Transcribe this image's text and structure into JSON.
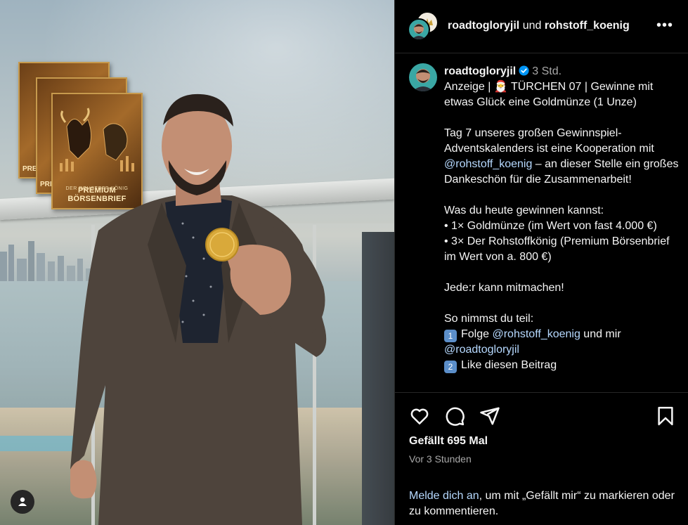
{
  "post": {
    "author": "roadtogloryjil",
    "connector": "und",
    "collaborator": "rohstoff_koenig",
    "more_label": "•••"
  },
  "image": {
    "book_brand": "DER ROHSTOFF-KÖNIG",
    "book_title": "PREMIUM BÖRSENBRIEF",
    "book_partial": "PRE"
  },
  "caption": {
    "username": "roadtogloryjil",
    "time": "3 Std.",
    "line1_pre": "Anzeige | 🎅 TÜRCHEN 07 | Gewinne mit etwas Glück eine Goldmünze (1 Unze)",
    "p2_a": "Tag 7 unseres großen Gewinnspiel-Adventskalenders ist eine Kooperation mit",
    "p2_mention": "@rohstoff_koenig",
    "p2_b": " – an dieser Stelle ein großes Dankeschön für die Zusammenarbeit!",
    "p3_title": "Was du heute gewinnen kannst:",
    "p3_item1": "• 1× Goldmünze (im Wert von fast 4.000 €)",
    "p3_item2": "• 3× Der Rohstoffkönig (Premium Börsenbrief im Wert von a. 800 €)",
    "p4": "Jede:r kann mitmachen!",
    "p5_title": "So nimmst du teil:",
    "step1_num": "1",
    "step1_text": "Folge",
    "step1_mention1": "@rohstoff_koenig",
    "step1_mid": " und mir",
    "step1_mention2": "@roadtogloryjil",
    "step2_num": "2",
    "step2_text": "Like diesen Beitrag"
  },
  "actions": {
    "like_icon": "heart-icon",
    "comment_icon": "comment-icon",
    "share_icon": "share-icon",
    "save_icon": "bookmark-icon",
    "likes_text": "Gefällt 695 Mal",
    "time_ago": "Vor 3 Stunden",
    "login_link": "Melde dich an",
    "login_rest": ", um mit „Gefällt mir“ zu markieren oder zu kommentieren."
  },
  "colors": {
    "background": "#000000",
    "text": "#f5f5f5",
    "muted": "#a8a8a8",
    "link": "#b6d9ff",
    "verified": "#0095f6",
    "divider": "#262626"
  }
}
